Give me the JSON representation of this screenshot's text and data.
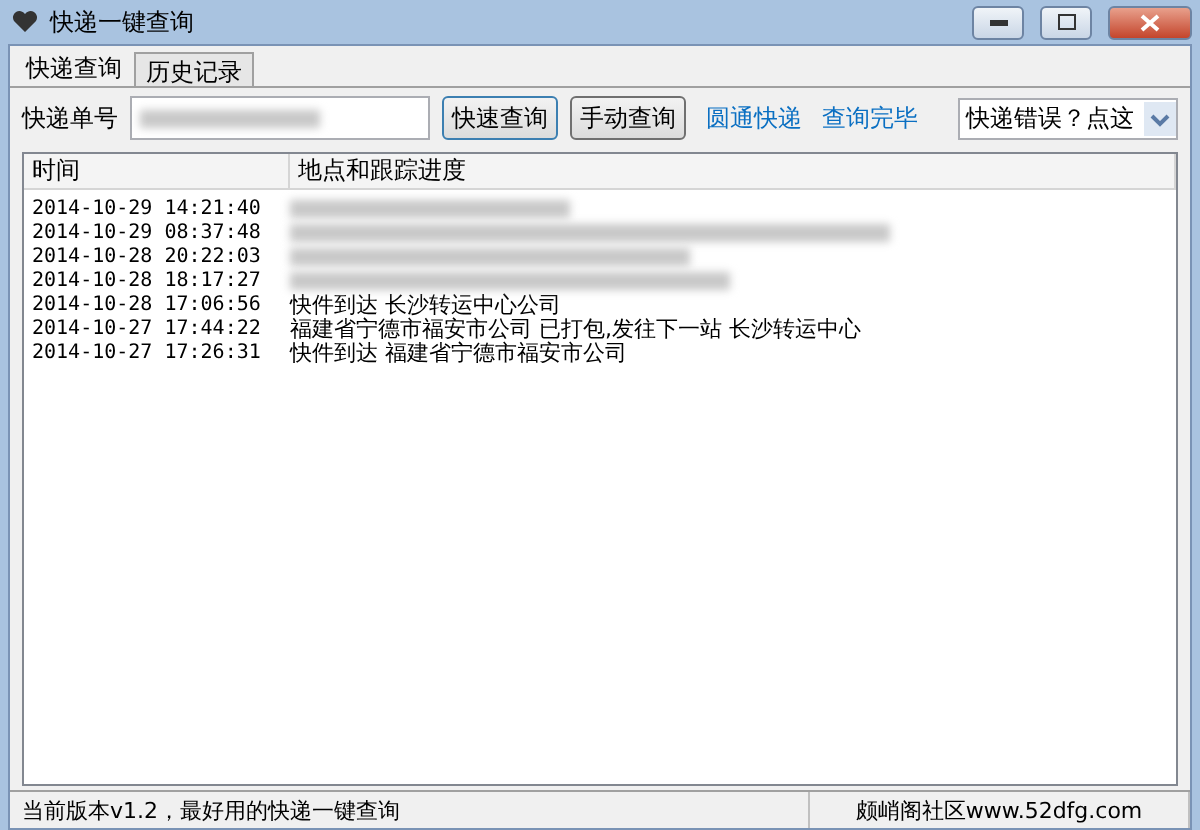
{
  "window": {
    "title": "快递一键查询"
  },
  "tabs": [
    {
      "label": "快递查询",
      "selected": true
    },
    {
      "label": "历史记录",
      "selected": false
    }
  ],
  "query": {
    "label": "快递单号",
    "value_blurred": true,
    "buttons": [
      "快速查询",
      "手动查询"
    ],
    "links": [
      "圆通快递",
      "查询完毕"
    ],
    "dropdown": {
      "value": "快递错误？点这"
    }
  },
  "table": {
    "columns": [
      "时间",
      "地点和跟踪进度"
    ],
    "rows": [
      {
        "time": "2014-10-29 14:21:40",
        "blurred": true
      },
      {
        "time": "2014-10-29 08:37:48",
        "blurred": true
      },
      {
        "time": "2014-10-28 20:22:03",
        "blurred": true
      },
      {
        "time": "2014-10-28 18:17:27",
        "blurred": true
      },
      {
        "time": "2014-10-28 17:06:56",
        "location": "快件到达 长沙转运中心公司"
      },
      {
        "time": "2014-10-27 17:44:22",
        "location": "福建省宁德市福安市公司 已打包,发往下一站 长沙转运中心"
      },
      {
        "time": "2014-10-27 17:26:31",
        "location": "快件到达 福建省宁德市福安市公司"
      }
    ]
  },
  "status_bar": [
    "当前版本v1.2，最好用的快递一键查询",
    "颇峭阁社区www.52dfg.com"
  ]
}
